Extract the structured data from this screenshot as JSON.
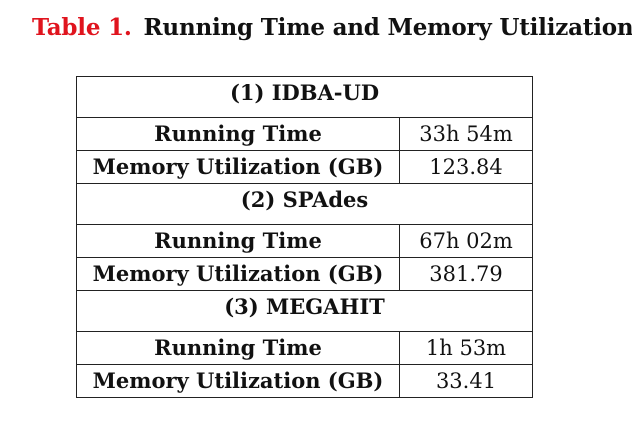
{
  "caption": {
    "label": "Table 1.",
    "title": "Running Time and Memory Utilization"
  },
  "sections": [
    {
      "heading": "(1) IDBA-UD",
      "rows": [
        {
          "metric": "Running Time",
          "value": "33h 54m"
        },
        {
          "metric": "Memory Utilization (GB)",
          "value": "123.84"
        }
      ]
    },
    {
      "heading": "(2) SPAdes",
      "rows": [
        {
          "metric": "Running Time",
          "value": "67h 02m"
        },
        {
          "metric": "Memory Utilization (GB)",
          "value": "381.79"
        }
      ]
    },
    {
      "heading": "(3) MEGAHIT",
      "rows": [
        {
          "metric": "Running Time",
          "value": "1h 53m"
        },
        {
          "metric": "Memory Utilization (GB)",
          "value": "33.41"
        }
      ]
    }
  ]
}
